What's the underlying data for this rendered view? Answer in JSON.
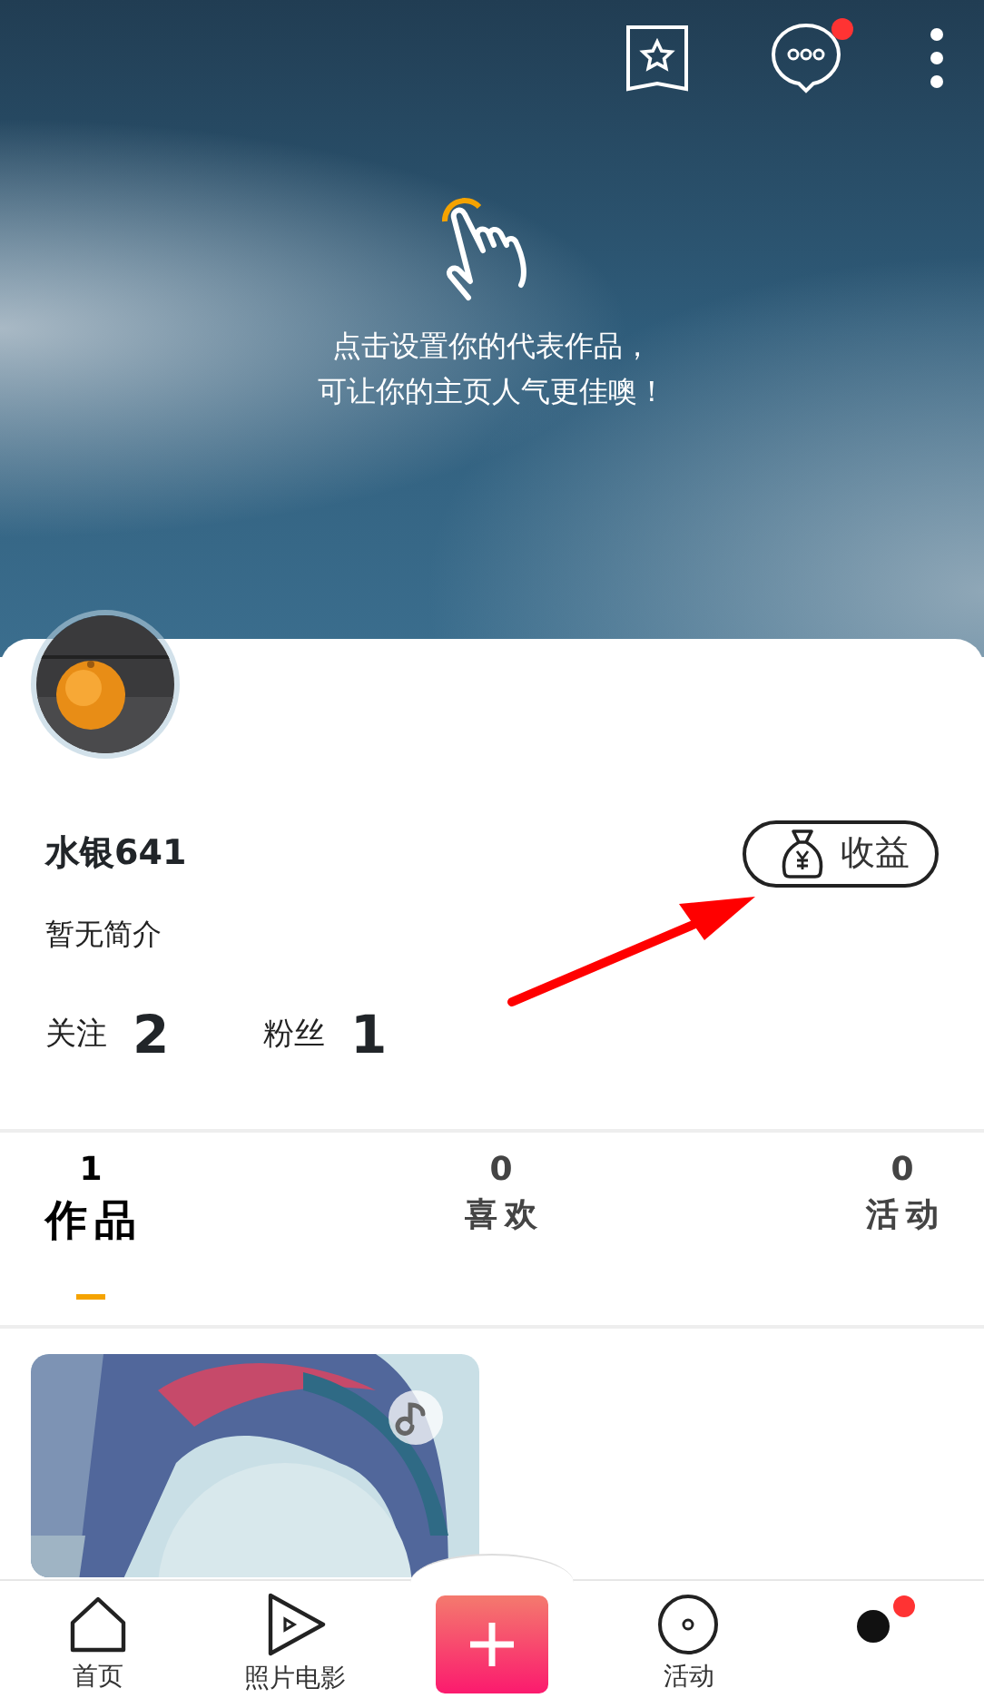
{
  "header": {
    "hint_lines": [
      "点击设置你的代表作品，",
      "可让你的主页人气更佳噢！"
    ],
    "message_unread": true
  },
  "profile": {
    "name": "水银641",
    "bio": "暂无简介",
    "earnings_button": "收益",
    "stats": [
      {
        "label": "关注",
        "value": "2"
      },
      {
        "label": "粉丝",
        "value": "1"
      }
    ]
  },
  "tabs": [
    {
      "count": "1",
      "label": "作品",
      "selected": true
    },
    {
      "count": "0",
      "label": "喜欢",
      "selected": false
    },
    {
      "count": "0",
      "label": "活动",
      "selected": false
    }
  ],
  "works": [
    {
      "kind": "picture",
      "has_music": true
    }
  ],
  "bottom_nav": [
    {
      "kind": "home",
      "label": "首页"
    },
    {
      "kind": "play",
      "label": "照片电影"
    },
    {
      "kind": "create"
    },
    {
      "kind": "disc",
      "label": "活动"
    },
    {
      "kind": "me",
      "badge": true
    }
  ]
}
